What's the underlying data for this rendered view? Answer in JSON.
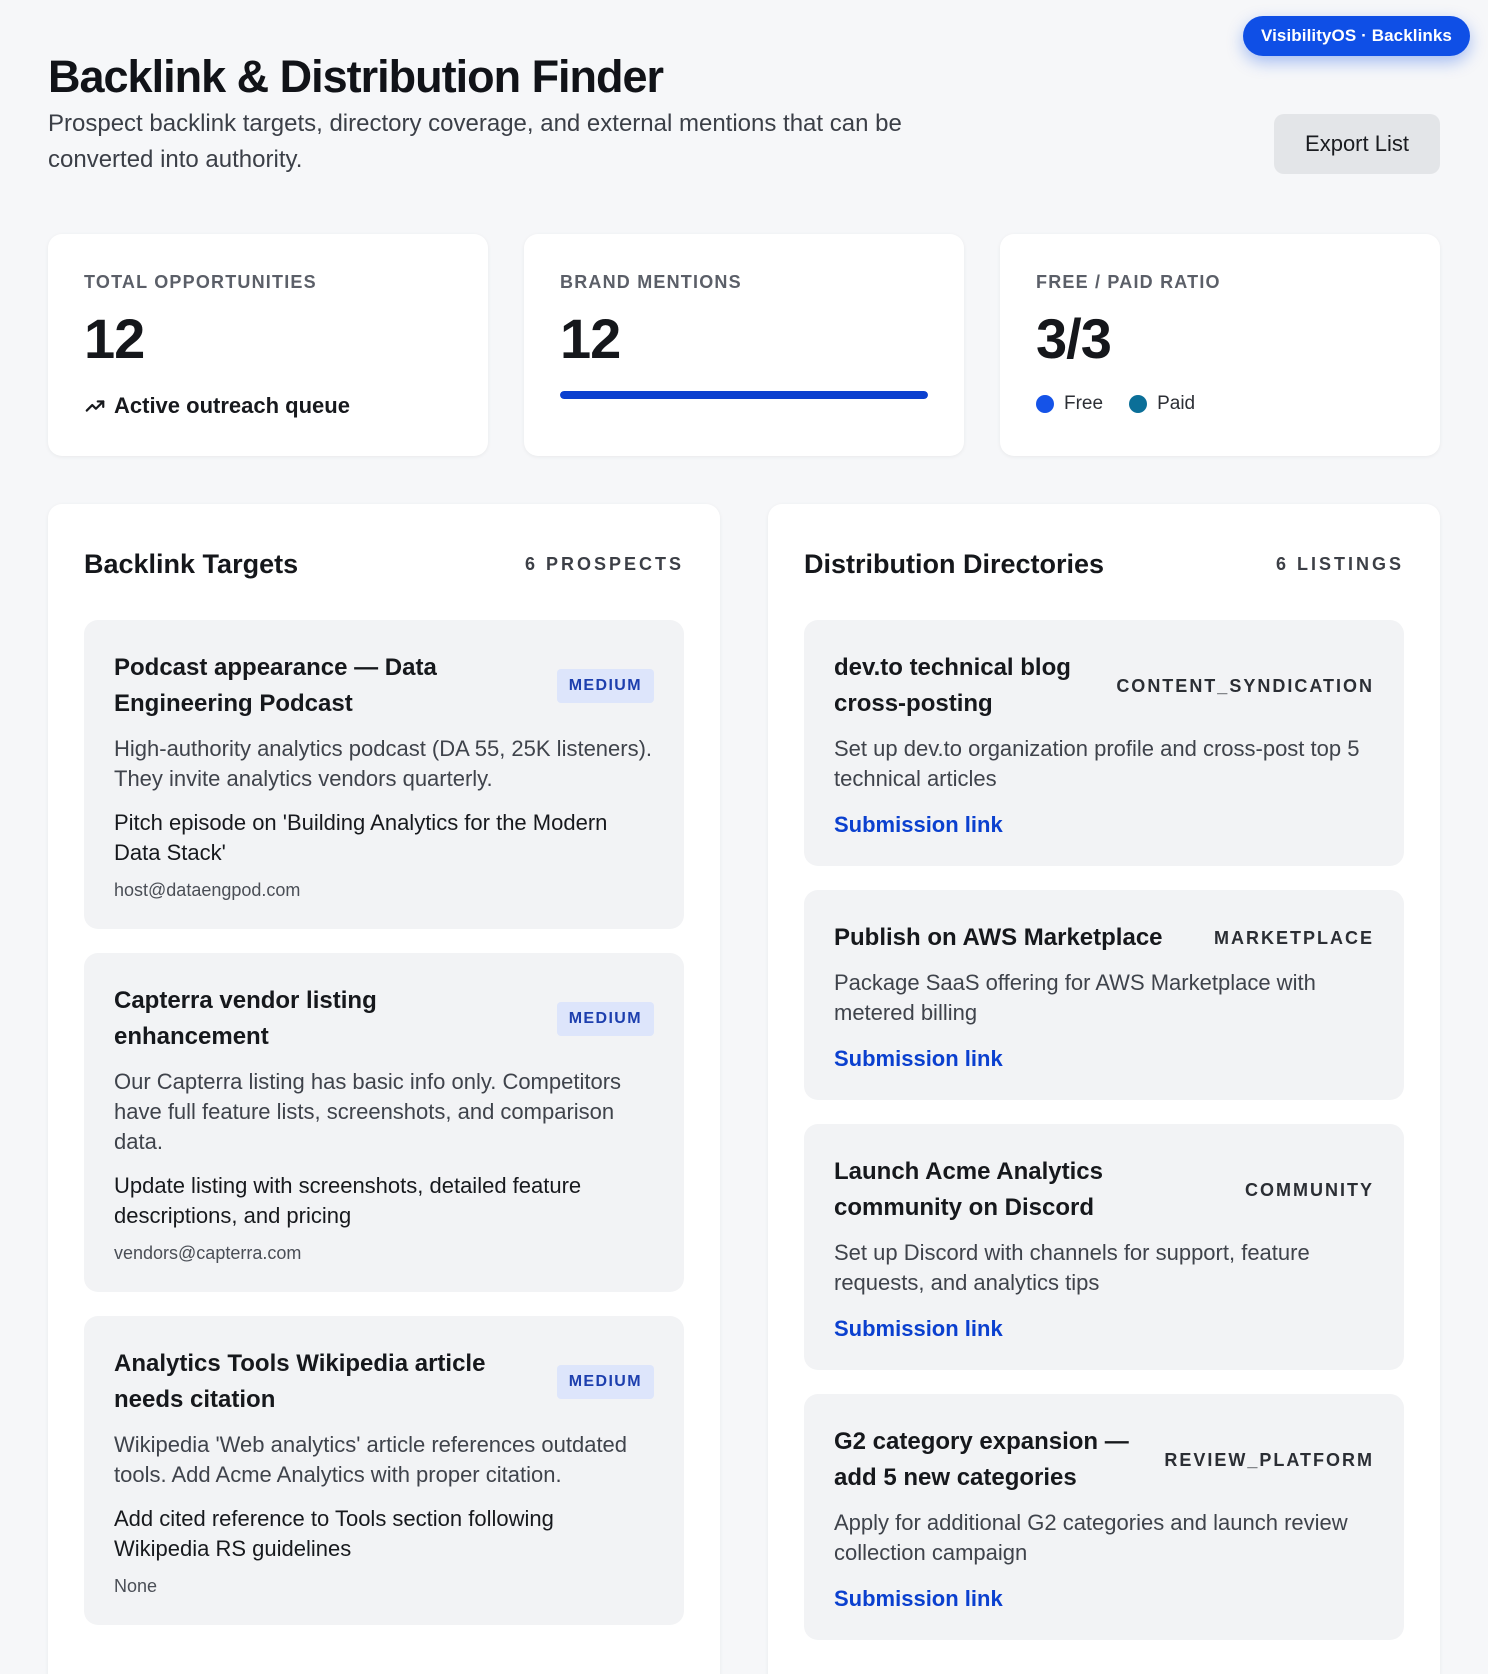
{
  "app_badge": "VisibilityOS · Backlinks",
  "header": {
    "title": "Backlink & Distribution Finder",
    "subtitle": "Prospect backlink targets, directory coverage, and external mentions that can be converted into authority.",
    "export_label": "Export List"
  },
  "stats": {
    "total": {
      "label": "TOTAL OPPORTUNITIES",
      "value": "12",
      "note": "Active outreach queue"
    },
    "mentions": {
      "label": "BRAND MENTIONS",
      "value": "12",
      "progress": 1.0
    },
    "ratio": {
      "label": "FREE / PAID RATIO",
      "value": "3/3",
      "free_label": "Free",
      "paid_label": "Paid"
    }
  },
  "colors": {
    "accent": "#0b40cf",
    "badge": "#0f4fe6",
    "free_dot": "#1553e8",
    "paid_dot": "#0b6f98"
  },
  "backlinks": {
    "title": "Backlink Targets",
    "count": "6 PROSPECTS",
    "items": [
      {
        "title": "Podcast appearance — Data Engineering Podcast",
        "priority": "MEDIUM",
        "description": "High-authority analytics podcast (DA 55, 25K listeners). They invite analytics vendors quarterly.",
        "action": "Pitch episode on 'Building Analytics for the Modern Data Stack'",
        "contact": "host@dataengpod.com"
      },
      {
        "title": "Capterra vendor listing enhancement",
        "priority": "MEDIUM",
        "description": "Our Capterra listing has basic info only. Competitors have full feature lists, screenshots, and comparison data.",
        "action": "Update listing with screenshots, detailed feature descriptions, and pricing",
        "contact": "vendors@capterra.com"
      },
      {
        "title": "Analytics Tools Wikipedia article needs citation",
        "priority": "MEDIUM",
        "description": "Wikipedia 'Web analytics' article references outdated tools. Add Acme Analytics with proper citation.",
        "action": "Add cited reference to Tools section following Wikipedia RS guidelines",
        "contact": "None"
      }
    ]
  },
  "directories": {
    "title": "Distribution Directories",
    "count": "6 LISTINGS",
    "link_label": "Submission link",
    "items": [
      {
        "title": "dev.to technical blog cross-posting",
        "category": "CONTENT_SYNDICATION",
        "description": "Set up dev.to organization profile and cross-post top 5 technical articles"
      },
      {
        "title": "Publish on AWS Marketplace",
        "category": "MARKETPLACE",
        "description": "Package SaaS offering for AWS Marketplace with metered billing"
      },
      {
        "title": "Launch Acme Analytics community on Discord",
        "category": "COMMUNITY",
        "description": "Set up Discord with channels for support, feature requests, and analytics tips"
      },
      {
        "title": "G2 category expansion — add 5 new categories",
        "category": "REVIEW_PLATFORM",
        "description": "Apply for additional G2 categories and launch review collection campaign"
      }
    ]
  }
}
